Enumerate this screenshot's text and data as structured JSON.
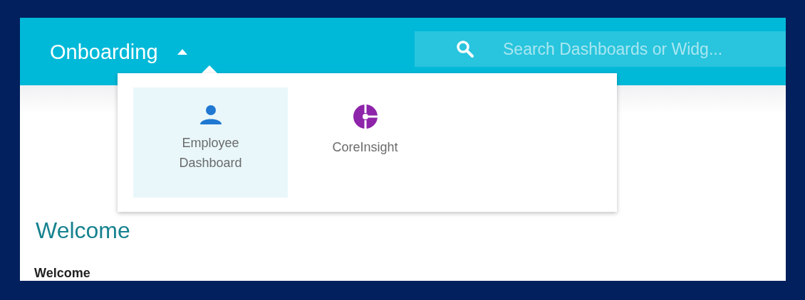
{
  "header": {
    "title": "Onboarding",
    "menu_expanded": true
  },
  "search": {
    "placeholder": "Search Dashboards or Widg..."
  },
  "dropdown_items": [
    {
      "label": "Employee Dashboard",
      "kind": "person",
      "selected": true
    },
    {
      "label": "CoreInsight",
      "kind": "logo",
      "selected": false
    }
  ],
  "content": {
    "heading": "Welcome",
    "subheading": "Welcome"
  }
}
